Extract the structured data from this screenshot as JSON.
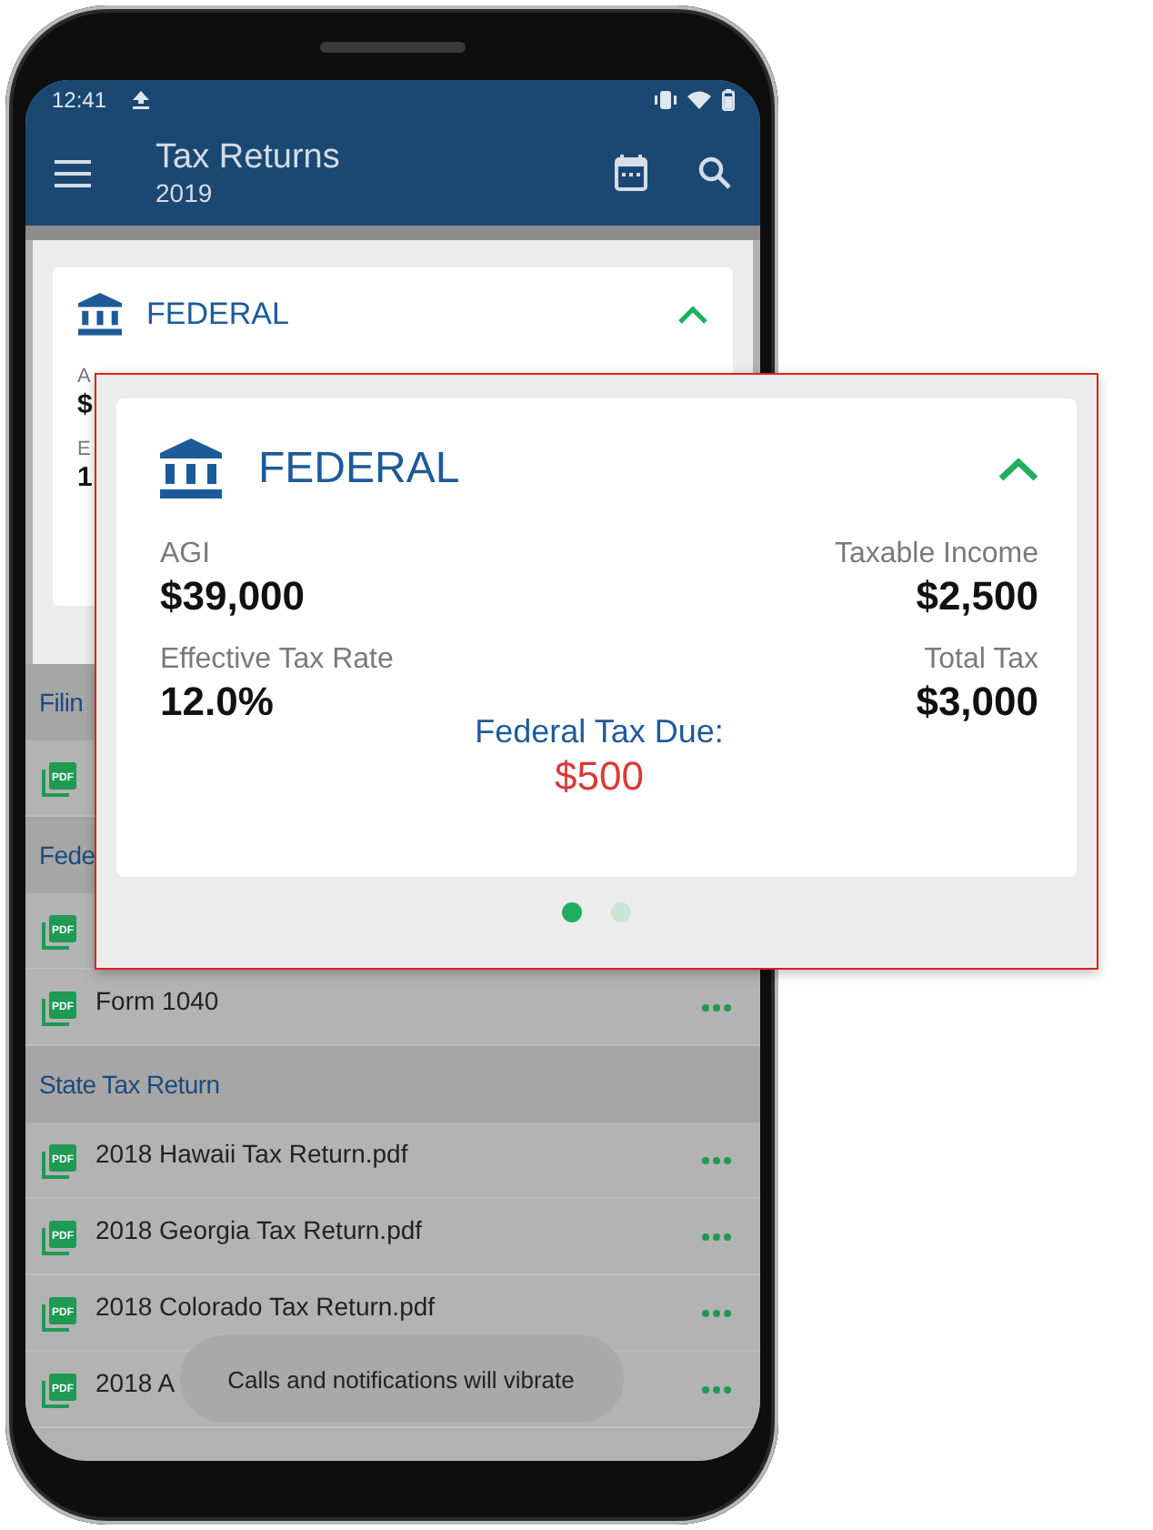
{
  "status_bar": {
    "time": "12:41"
  },
  "app_bar": {
    "title": "Tax Returns",
    "subtitle": "2019"
  },
  "summary_card": {
    "title": "FEDERAL",
    "expanded": true,
    "fields": [
      {
        "text": "A",
        "kind": "label"
      },
      {
        "text": "$",
        "kind": "value"
      },
      {
        "text": "E",
        "kind": "label"
      },
      {
        "text": "1",
        "kind": "value"
      }
    ]
  },
  "sections": [
    {
      "title": "Filin",
      "files": [
        {
          "kind": "pdf",
          "icon_label": "PDF",
          "menu": false
        }
      ]
    },
    {
      "title": "Fede",
      "files": [
        {
          "kind": "pdf",
          "icon_label": "PDF",
          "menu": false
        },
        {
          "kind": "pdf",
          "icon_label": "PDF",
          "name": "Form 1040",
          "menu": true
        }
      ]
    },
    {
      "title": "State Tax Return",
      "files": [
        {
          "kind": "pdf",
          "icon_label": "PDF",
          "name": "2018 Hawaii Tax Return.pdf",
          "menu": true
        },
        {
          "kind": "pdf",
          "icon_label": "PDF",
          "name": "2018 Georgia Tax Return.pdf",
          "menu": true
        },
        {
          "kind": "pdf",
          "icon_label": "PDF",
          "name": "2018 Colorado Tax Return.pdf",
          "menu": true
        },
        {
          "kind": "pdf",
          "icon_label": "PDF",
          "name": "2018 A",
          "menu": true
        }
      ]
    }
  ],
  "toast": "Calls and notifications will vibrate",
  "popup": {
    "title": "FEDERAL",
    "expanded": true,
    "stats": [
      {
        "label": "AGI",
        "value": "$39,000"
      },
      {
        "label": "Taxable Income",
        "value": "$2,500"
      },
      {
        "label": "Effective Tax Rate",
        "value": "12.0%"
      },
      {
        "label": "Total Tax",
        "value": "$3,000"
      }
    ],
    "due_label": "Federal Tax Due:",
    "due_value": "$500",
    "pages": [
      {
        "selected": true
      },
      {
        "selected": false
      }
    ]
  }
}
